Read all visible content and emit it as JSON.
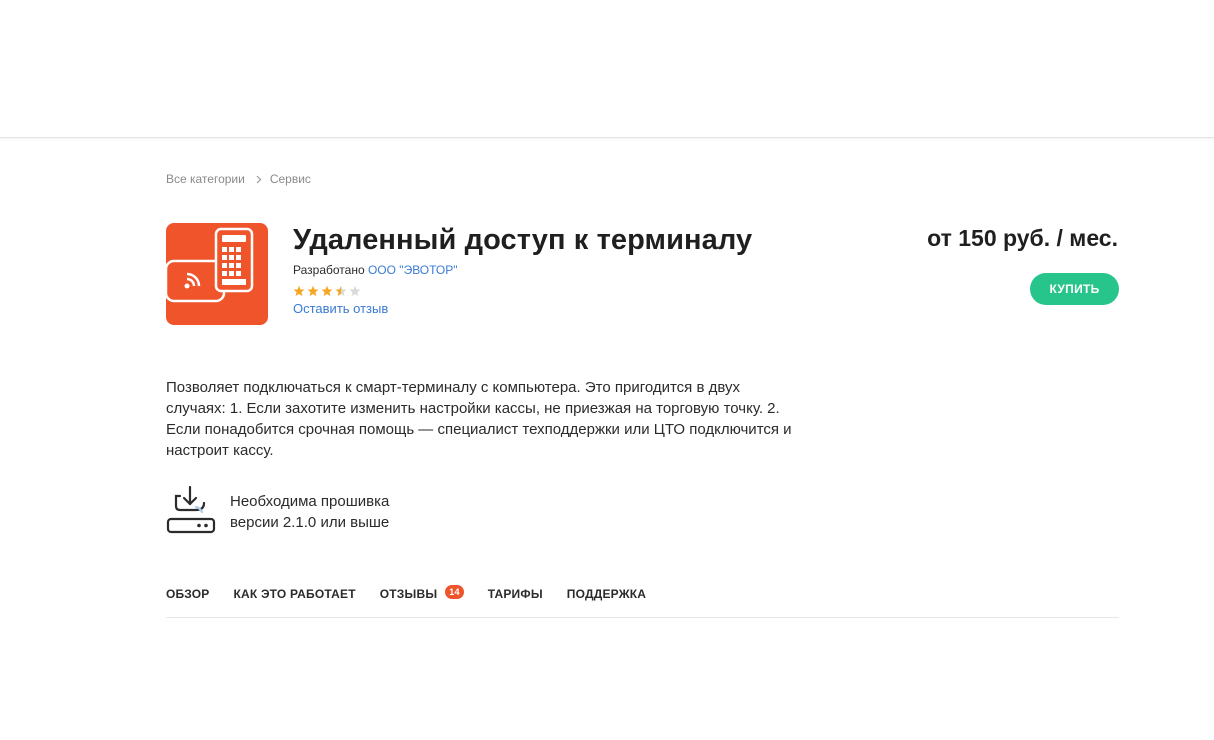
{
  "breadcrumb": {
    "items": [
      "Все категории",
      "Сервис"
    ]
  },
  "app": {
    "title": "Удаленный доступ к терминалу",
    "developer_prefix": "Разработано",
    "developer_name": "ООО \"ЭВОТОР\"",
    "rating": 3.5,
    "rating_max": 5,
    "review_link": "Оставить отзыв",
    "price": "от 150 руб. / мес.",
    "buy_label": "КУПИТЬ",
    "icon": "terminal-wireless-icon",
    "description": "Позволяет подключаться к смарт-терминалу с компьютера. Это пригодится в двух случаях: 1. Если захотите изменить настройки кассы, не приезжая на торговую точку. 2. Если понадобится срочная помощь — специалист техподдержки или ЦТО подключится и настроит кассу.",
    "firmware": {
      "icon": "firmware-download-icon",
      "line1": "Необходима прошивка",
      "line2": "версии 2.1.0 или выше"
    }
  },
  "tabs": [
    {
      "label": "ОБЗОР"
    },
    {
      "label": "КАК ЭТО РАБОТАЕТ"
    },
    {
      "label": "ОТЗЫВЫ",
      "badge": "14"
    },
    {
      "label": "ТАРИФЫ"
    },
    {
      "label": "ПОДДЕРЖКА"
    }
  ],
  "colors": {
    "accent": "#f0542b",
    "buy": "#27c48b",
    "link": "#3a7bd5",
    "star_filled": "#f5a623",
    "star_empty": "#d9d9d9"
  }
}
